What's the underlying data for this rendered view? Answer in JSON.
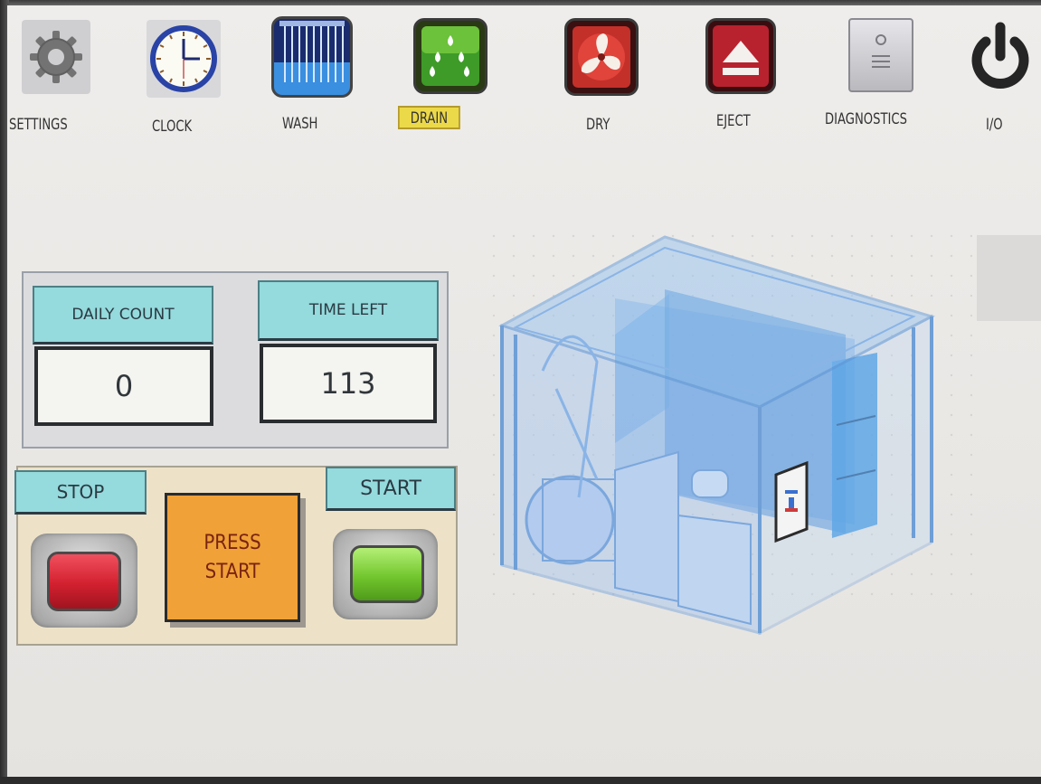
{
  "toolbar": {
    "settings": "SETTINGS",
    "clock": "CLOCK",
    "wash": "WASH",
    "drain": "DRAIN",
    "dry": "DRY",
    "eject": "EJECT",
    "diagnostics": "DIAGNOSTICS",
    "power": "I/O",
    "active": "drain"
  },
  "counts": {
    "daily_count_label": "DAILY COUNT",
    "daily_count_value": "0",
    "time_left_label": "TIME LEFT",
    "time_left_value": "113"
  },
  "control": {
    "stop_label": "STOP",
    "start_label": "START",
    "status_line1": "PRESS",
    "status_line2": "START"
  },
  "colors": {
    "accent_header": "#95dadc",
    "active_tab": "#ecd94a",
    "stop_button": "#d8253a",
    "start_button": "#6ec428",
    "status_box": "#f0a138",
    "machine_blue": "#3f8fd8"
  },
  "icons": [
    "gear-icon",
    "clock-icon",
    "wash-icon",
    "drain-icon",
    "fan-icon",
    "eject-icon",
    "diagnostics-icon",
    "power-icon",
    "machine-illustration"
  ]
}
